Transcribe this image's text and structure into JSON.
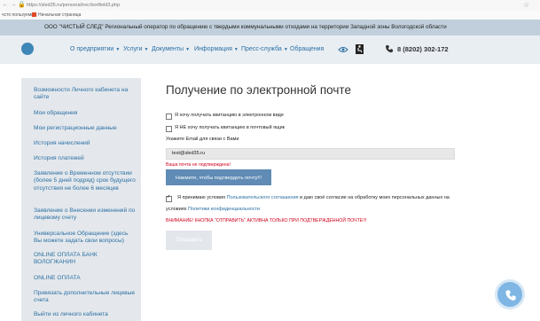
{
  "browser": {
    "url": "https://sled35.ru/personal/rec/textfield3.php",
    "bookmarks": [
      "чсто пользуемые",
      "Начальная страница"
    ]
  },
  "header": {
    "org_text": "ООО \"ЧИСТЫЙ СЛЕД\" Региональный оператор по обращению с твердыми коммунальными отходами на территории Западной зоны Вологодской области",
    "nav": [
      "О предприятии",
      "Услуги",
      "Документы",
      "Информация",
      "Пресс-служба",
      "Обращения"
    ],
    "phone": "8 (8202) 302-172"
  },
  "sidebar": {
    "items": [
      "Возможности Личного кабинета на сайте",
      "Мои обращения",
      "Мои регистрационные данные",
      "История начислений",
      "История платежей",
      "Заявление о Временном отсутствии (более 5 дней подряд) срок будущего отсутствия не более 6 месяцев",
      "Заявление о Внесении изменений по лицевому счету",
      "Универсальное Обращение (здесь Вы можете задать свои вопросы)",
      "ONLINE ОПЛАТА БАНК ВОЛОГЖАНИН",
      "ONLINE ОПЛАТА",
      "Привязать дополнительные лицевые счета",
      "Выйти из личного кабинета"
    ]
  },
  "main": {
    "title": "Получение по электронной почте",
    "option_electronic": "Я хочу получать квитанцию в электронном виде",
    "option_no_paper": "Я НЕ хочу получать квитанцию в почтовый ящик",
    "email_label": "Укажите Email для связи с Вами",
    "email_value": "test@sled35.ru",
    "email_error": "Ваша почта не подтверждена!",
    "confirm_button": "Нажмите, чтобы подтвердить почту!!!",
    "agree_prefix": "Я принимаю условия",
    "agree_link1": "Пользовательского соглашения",
    "agree_middle": "и даю своё согласие на обработку моих персональных данных на",
    "agree_prefix2": "условиях",
    "agree_link2": "Политики конфиденциальности",
    "warning": "ВНИМАНИЕ! КНОПКА \"ОТПРАВИТЬ\" АКТИВНА ТОЛЬКО ПРИ ПОДТВЕРЖДЕННОЙ ПОЧТЕ!!!",
    "send_button": "Отправить"
  }
}
